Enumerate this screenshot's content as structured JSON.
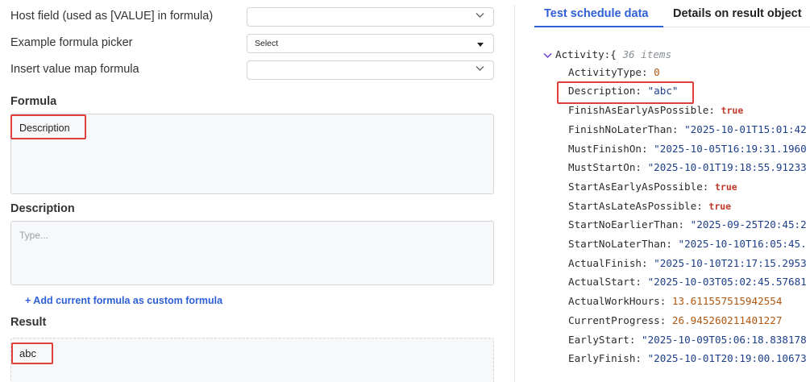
{
  "form": {
    "host_field": {
      "label": "Host field (used as [VALUE] in formula)",
      "value": ""
    },
    "formula_picker": {
      "label": "Example formula picker",
      "value": "Select"
    },
    "value_map": {
      "label": "Insert value map formula",
      "value": ""
    },
    "formula": {
      "title": "Formula",
      "value": "Description"
    },
    "description": {
      "title": "Description",
      "placeholder": "Type..."
    },
    "add_link": "+ Add current formula as custom formula",
    "result": {
      "title": "Result",
      "value": "abc"
    }
  },
  "tabs": [
    "Test schedule data",
    "Details on result object"
  ],
  "tree": {
    "root_key": "Activity:",
    "root_brace": "{",
    "root_count": "36 items",
    "rows": [
      {
        "key": "ActivityType:",
        "value": "0",
        "type": "num"
      },
      {
        "key": "Description:",
        "value": "\"abc\"",
        "type": "str"
      },
      {
        "key": "FinishAsEarlyAsPossible:",
        "value": "true",
        "type": "bool"
      },
      {
        "key": "FinishNoLaterThan:",
        "value": "\"2025-10-01T15:01:42",
        "type": "str"
      },
      {
        "key": "MustFinishOn:",
        "value": "\"2025-10-05T16:19:31.1960",
        "type": "str"
      },
      {
        "key": "MustStartOn:",
        "value": "\"2025-10-01T19:18:55.91233",
        "type": "str"
      },
      {
        "key": "StartAsEarlyAsPossible:",
        "value": "true",
        "type": "bool"
      },
      {
        "key": "StartAsLateAsPossible:",
        "value": "true",
        "type": "bool"
      },
      {
        "key": "StartNoEarlierThan:",
        "value": "\"2025-09-25T20:45:2",
        "type": "str"
      },
      {
        "key": "StartNoLaterThan:",
        "value": "\"2025-10-10T16:05:45.",
        "type": "str"
      },
      {
        "key": "ActualFinish:",
        "value": "\"2025-10-10T21:17:15.2953",
        "type": "str"
      },
      {
        "key": "ActualStart:",
        "value": "\"2025-10-03T05:02:45.57681",
        "type": "str"
      },
      {
        "key": "ActualWorkHours:",
        "value": "13.611557515942554",
        "type": "num"
      },
      {
        "key": "CurrentProgress:",
        "value": "26.945260211401227",
        "type": "num"
      },
      {
        "key": "EarlyStart:",
        "value": "\"2025-10-09T05:06:18.838178",
        "type": "str"
      },
      {
        "key": "EarlyFinish:",
        "value": "\"2025-10-01T20:19:00.10673",
        "type": "str"
      }
    ]
  },
  "colors": {
    "accent": "#2f5fd6",
    "highlight": "#e0403d",
    "number": "#b0560f",
    "string": "#1d3e8a",
    "boolean": "#c0392b"
  }
}
